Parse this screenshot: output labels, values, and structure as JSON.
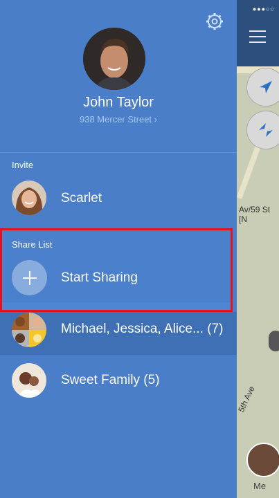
{
  "profile": {
    "name": "John Taylor",
    "address": "938 Mercer Street ›"
  },
  "invite": {
    "section_label": "Invite",
    "contact_name": "Scarlet"
  },
  "share_list": {
    "section_label": "Share List",
    "start_label": "Start Sharing"
  },
  "groups": [
    {
      "label": "Michael, Jessica, Alice... (7)"
    },
    {
      "label": "Sweet Family (5)"
    }
  ],
  "map": {
    "status_dots": "●●●○○",
    "street_top": "Av/59 St [N",
    "street_side": "5th Ave",
    "me_label": "Me"
  },
  "colors": {
    "drawer_bg": "#4a7ec9",
    "highlight_border": "#e3141b",
    "address_text": "#a9c6ee"
  },
  "icons": {
    "settings": "gear-icon",
    "add": "plus-icon",
    "menu": "hamburger-icon"
  }
}
